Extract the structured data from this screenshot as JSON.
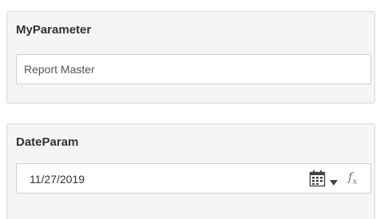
{
  "parameters": [
    {
      "title": "MyParameter",
      "value": "Report Master"
    },
    {
      "title": "DateParam",
      "value": "11/27/2019",
      "icons": [
        "calendar-icon",
        "dropdown-caret-icon",
        "function-fx-icon"
      ],
      "fx_label": "f",
      "fx_sub": "x"
    }
  ],
  "colors": {
    "panel_bg": "#f5f5f5",
    "panel_border": "#d9d9d9",
    "title_text": "#333333",
    "icon": "#444444"
  }
}
